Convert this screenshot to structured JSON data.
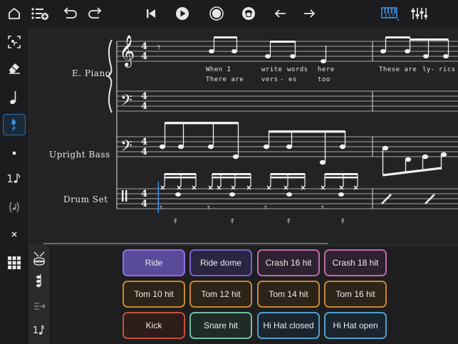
{
  "toolbar": {
    "left": [
      "home-icon",
      "add-list-icon",
      "undo-icon",
      "redo-icon"
    ],
    "center": [
      "skip-back-icon",
      "play-icon",
      "record-icon",
      "metronome-icon",
      "arrow-left-icon",
      "arrow-right-icon"
    ],
    "right": [
      "piano-keyboard-icon",
      "mixer-icon"
    ]
  },
  "sidebar": {
    "tools": [
      "select-tool-icon",
      "eraser-icon",
      "quarter-note-icon",
      "quarter-rest-icon",
      "dot-icon",
      "tuplet-icon",
      "parentheses-icon",
      "close-x-icon",
      "grid-icon"
    ],
    "selected": "quarter-rest-icon",
    "tuplet_label": "1"
  },
  "score": {
    "time_signature": "4/4",
    "instruments": [
      "E. Piano",
      "Upright Bass",
      "Drum Set"
    ],
    "lyrics": {
      "line1": [
        "When I",
        "write",
        "words",
        "here",
        "These are",
        "ly-",
        "rics"
      ],
      "line2": [
        "There are",
        "vers",
        "-",
        "es",
        "too"
      ]
    }
  },
  "drum_panel": {
    "side_icons": [
      "drum-kit-icon",
      "note-stack-icon",
      "arrow-icon",
      "tuplet-small-icon"
    ],
    "side_number": "1",
    "pads": [
      {
        "label": "Ride",
        "color": "#8a6fe0",
        "fill": "#5a4a9a"
      },
      {
        "label": "Ride dome",
        "color": "#7a62c8",
        "fill": "#2a2540"
      },
      {
        "label": "Crash 16 hit",
        "color": "#c06aa8",
        "fill": "#2e2230"
      },
      {
        "label": "Crash 18 hit",
        "color": "#c06aa8",
        "fill": "#2e2230"
      },
      {
        "label": "Tom 10 hit",
        "color": "#c9862c",
        "fill": "#2c2418"
      },
      {
        "label": "Tom 12 hit",
        "color": "#c9862c",
        "fill": "#2c2418"
      },
      {
        "label": "Tom 14 hit",
        "color": "#c9862c",
        "fill": "#2c2418"
      },
      {
        "label": "Tom 16 hit",
        "color": "#c9862c",
        "fill": "#2c2418"
      },
      {
        "label": "Kick",
        "color": "#c6503a",
        "fill": "#2e1c19"
      },
      {
        "label": "Snare hit",
        "color": "#6fbfa0",
        "fill": "#1f2b27"
      },
      {
        "label": "Hi Hat closed",
        "color": "#4fa0c8",
        "fill": "#1b2530"
      },
      {
        "label": "Hi Hat open",
        "color": "#4fa0c8",
        "fill": "#1b2530"
      }
    ]
  }
}
